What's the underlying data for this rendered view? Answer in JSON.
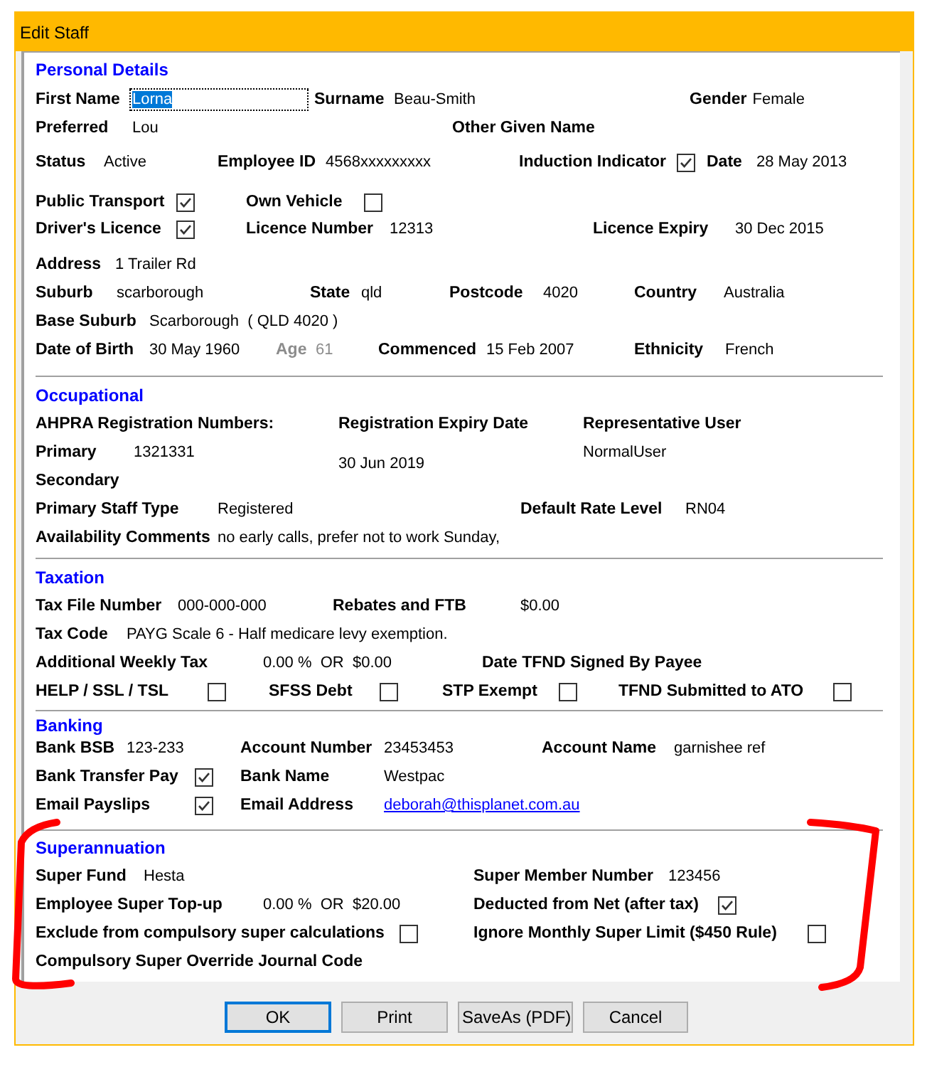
{
  "window": {
    "title": "Edit Staff"
  },
  "sections": [
    {
      "title": "Personal Details",
      "marked": false,
      "rows": [
        [
          {
            "kind": "input",
            "label": "First Name",
            "value": "Lorna",
            "focused": true
          },
          {
            "kind": "text",
            "label": "Surname",
            "value": "Beau-Smith"
          },
          {
            "kind": "text",
            "label": "Gender",
            "value": "Female"
          }
        ],
        [
          {
            "kind": "text",
            "label": "Preferred",
            "value": "Lou"
          },
          {
            "kind": "text",
            "label": "Other Given Name"
          }
        ],
        [
          {
            "kind": "text",
            "label": "Status",
            "value": "Active"
          },
          {
            "kind": "text",
            "label": "Employee ID",
            "value": "4568xxxxxxxxx"
          },
          {
            "kind": "checkbox",
            "label": "Induction Indicator",
            "checked": true
          },
          {
            "kind": "text",
            "label": "Date",
            "value": "28 May 2013"
          }
        ],
        [
          {
            "kind": "checkbox",
            "label": "Public Transport",
            "checked": true
          },
          {
            "kind": "checkbox",
            "label": "Own Vehicle",
            "checked": false
          }
        ],
        [
          {
            "kind": "checkbox",
            "label": "Driver's Licence",
            "checked": true
          },
          {
            "kind": "text",
            "label": "Licence Number",
            "value": "12313"
          },
          {
            "kind": "text",
            "label": "Licence Expiry",
            "value": "30 Dec 2015"
          }
        ],
        [
          {
            "kind": "text",
            "label": "Address",
            "value": "1 Trailer Rd"
          }
        ],
        [
          {
            "kind": "text",
            "label": "Suburb",
            "value": "scarborough"
          },
          {
            "kind": "text",
            "label": "State",
            "value": "qld"
          },
          {
            "kind": "text",
            "label": "Postcode",
            "value": "4020"
          },
          {
            "kind": "text",
            "label": "Country",
            "value": "Australia"
          }
        ],
        [
          {
            "kind": "text",
            "label": "Base Suburb",
            "value": "Scarborough  ( QLD 4020 )"
          }
        ],
        [
          {
            "kind": "text",
            "label": "Date of Birth",
            "value": "30 May 1960"
          },
          {
            "kind": "greyed",
            "label": "Age",
            "value": "61"
          },
          {
            "kind": "text",
            "label": "Commenced",
            "value": "15 Feb 2007"
          },
          {
            "kind": "text",
            "label": "Ethnicity",
            "value": "French"
          }
        ]
      ]
    },
    {
      "title": "Occupational",
      "marked": false,
      "registration": [
        [
          {
            "kind": "text",
            "label": "AHPRA Registration Numbers:"
          },
          {
            "kind": "text",
            "label": "Registration Expiry Date"
          },
          {
            "kind": "text",
            "label": "Representative User"
          }
        ],
        [
          {
            "kind": "text",
            "label": "Primary",
            "value": "1321331"
          },
          {
            "kind": "text",
            "value": "30 Jun 2019"
          },
          {
            "kind": "text",
            "value": "NormalUser"
          }
        ],
        [
          {
            "kind": "text",
            "label": "Secondary"
          }
        ]
      ],
      "rows": [
        [
          {
            "kind": "text",
            "label": "Primary Staff Type",
            "value": "Registered"
          },
          {
            "kind": "text",
            "label": "Default Rate Level",
            "value": "RN04"
          }
        ],
        [
          {
            "kind": "text",
            "label": "Availability Comments",
            "value": "no early calls, prefer not to work Sunday,"
          }
        ]
      ]
    },
    {
      "title": "Taxation",
      "marked": false,
      "rows": [
        [
          {
            "kind": "text",
            "label": "Tax File Number",
            "value": "000-000-000"
          },
          {
            "kind": "text",
            "label": "Rebates and FTB",
            "value": "$0.00"
          }
        ],
        [
          {
            "kind": "text",
            "label": "Tax Code",
            "value": "PAYG Scale 6 - Half medicare levy exemption."
          }
        ],
        [
          {
            "kind": "text",
            "label": "Additional Weekly Tax",
            "value": "0.00 %  OR  $0.00"
          },
          {
            "kind": "text",
            "label": "Date TFND Signed By Payee"
          }
        ],
        [
          {
            "kind": "checkbox",
            "label": "HELP / SSL / TSL",
            "checked": false
          },
          {
            "kind": "checkbox",
            "label": "SFSS Debt",
            "checked": false
          },
          {
            "kind": "checkbox",
            "label": "STP Exempt",
            "checked": false
          },
          {
            "kind": "checkbox",
            "label": "TFND Submitted to ATO",
            "checked": false
          }
        ]
      ]
    },
    {
      "title": "Banking",
      "marked": false,
      "rows": [
        [
          {
            "kind": "text",
            "label": "Bank BSB",
            "value": "123-233"
          },
          {
            "kind": "text",
            "label": "Account Number",
            "value": "23453453"
          },
          {
            "kind": "text",
            "label": "Account Name",
            "value": "garnishee ref"
          }
        ],
        [
          {
            "kind": "checkbox",
            "label": "Bank Transfer Pay",
            "checked": true
          },
          {
            "kind": "text",
            "label": "Bank Name",
            "value": "Westpac"
          }
        ],
        [
          {
            "kind": "checkbox",
            "label": "Email Payslips",
            "checked": true
          },
          {
            "kind": "link",
            "label": "Email Address",
            "value": "deborah@thisplanet.com.au"
          }
        ]
      ]
    },
    {
      "title": "Superannuation",
      "marked": true,
      "rows": [
        [
          {
            "kind": "text",
            "label": "Super Fund",
            "value": "Hesta"
          },
          {
            "kind": "text",
            "label": "Super Member Number",
            "value": "123456"
          }
        ],
        [
          {
            "kind": "text",
            "label": "Employee Super Top-up",
            "value": "0.00 %  OR  $20.00"
          },
          {
            "kind": "checkbox",
            "label": "Deducted from Net (after tax)",
            "checked": true
          }
        ],
        [
          {
            "kind": "checkbox",
            "label": "Exclude from compulsory super calculations",
            "checked": false
          },
          {
            "kind": "checkbox",
            "label": "Ignore Monthly Super Limit ($450 Rule)",
            "checked": false
          }
        ],
        [
          {
            "kind": "text",
            "label": "Compulsory Super Override Journal Code"
          }
        ]
      ]
    }
  ],
  "buttons": [
    {
      "label": "OK",
      "default": true
    },
    {
      "label": "Print",
      "default": false
    },
    {
      "label": "SaveAs (PDF)",
      "default": false
    },
    {
      "label": "Cancel",
      "default": false
    }
  ]
}
